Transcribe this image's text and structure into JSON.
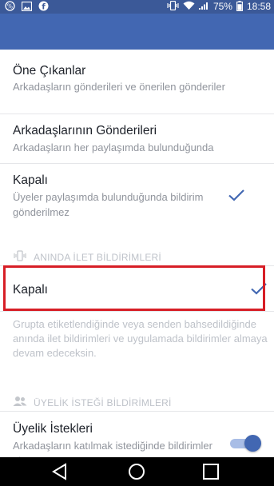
{
  "status_bar": {
    "battery_percent": "75%",
    "time": "18:58",
    "icons": [
      "percent-notification-icon",
      "image-notification-icon",
      "facebook-notification-icon",
      "vibrate-icon",
      "wifi-icon",
      "signal-icon",
      "battery-icon"
    ]
  },
  "settings": {
    "option_highlights": {
      "title": "Öne Çıkanlar",
      "subtitle": "Arkadaşların gönderileri ve önerilen gönderiler"
    },
    "option_friends_posts": {
      "title": "Arkadaşlarının Gönderileri",
      "subtitle": "Arkadaşların her paylaşımda bulunduğunda"
    },
    "option_off": {
      "title": "Kapalı",
      "subtitle": "Üyeler paylaşımda bulunduğunda bildirim gönderilmez",
      "selected": true
    },
    "push_section": {
      "title": "ANINDA İLET BİLDİRİMLERİ",
      "icon": "phone-vibrate-icon"
    },
    "push_off": {
      "title": "Kapalı",
      "selected": true
    },
    "push_help": "Grupta etiketlendiğinde veya senden bahsedildiğinde anında ilet bildirimleri ve uygulamada bildirimler almaya devam edeceksin.",
    "membership_section": {
      "title": "ÜYELİK İSTEĞİ BİLDİRİMLERİ",
      "icon": "people-icon"
    },
    "membership_requests": {
      "title": "Üyelik İstekleri",
      "subtitle": "Arkadaşların katılmak istediğinde bildirimler al",
      "toggle_on": true
    }
  },
  "colors": {
    "app_bar": "#4267b2",
    "status_bar": "#3b5998",
    "check": "#4267b2",
    "highlight_border": "#d71e26"
  },
  "nav_bar": {
    "icons": [
      "back-icon",
      "home-icon",
      "recents-icon"
    ]
  }
}
